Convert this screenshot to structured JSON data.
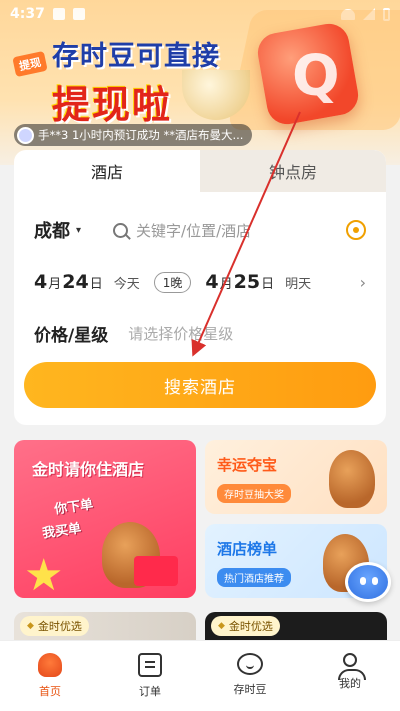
{
  "status_bar": {
    "time": "4:37"
  },
  "hero": {
    "badge": "提现",
    "line1": "存时豆可直接",
    "line2": "提现啦",
    "ticker": "手**3 1小时内预订成功 **酒店布曼大..."
  },
  "search": {
    "tabs": [
      {
        "label": "酒店",
        "active": true
      },
      {
        "label": "钟点房",
        "active": false
      }
    ],
    "city": "成都",
    "keyword_placeholder": "关键字/位置/酒店",
    "checkin": {
      "month": "4",
      "day": "24",
      "month_unit": "月",
      "day_unit": "日",
      "weekday": "今天"
    },
    "nights": "1晚",
    "checkout": {
      "month": "4",
      "day": "25",
      "month_unit": "月",
      "day_unit": "日",
      "weekday": "明天"
    },
    "price_label": "价格/星级",
    "price_placeholder": "请选择价格星级",
    "search_button": "搜索酒店"
  },
  "promos": {
    "big": {
      "title": "金时请你住酒店",
      "sub1": "你下单",
      "sub2": "我买单"
    },
    "small": [
      {
        "title": "幸运夺宝",
        "tag": "存时豆抽大奖"
      },
      {
        "title": "酒店榜单",
        "tag": "热门酒店推荐"
      }
    ],
    "strips": [
      {
        "tag": "金时优选"
      },
      {
        "tag": "金时优选"
      }
    ]
  },
  "nav": [
    {
      "label": "首页",
      "active": true,
      "icon": "home-icon"
    },
    {
      "label": "订单",
      "active": false,
      "icon": "order-icon"
    },
    {
      "label": "存时豆",
      "active": false,
      "icon": "bean-icon"
    },
    {
      "label": "我的",
      "active": false,
      "icon": "profile-icon"
    }
  ],
  "colors": {
    "accent": "#ff9c10",
    "nav_active": "#e85412",
    "arrow": "#d9302c"
  }
}
